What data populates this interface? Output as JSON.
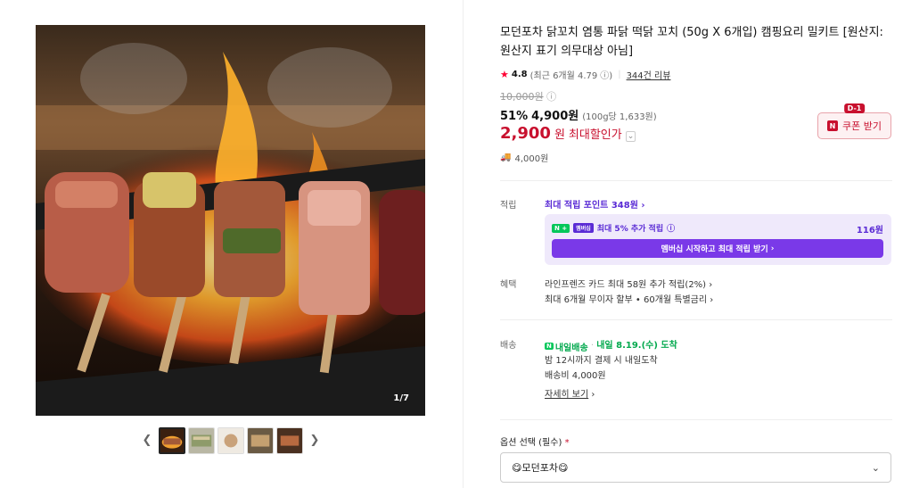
{
  "gallery": {
    "counter": "1/7",
    "prev_icon": "chevron-left-icon",
    "next_icon": "chevron-right-icon",
    "thumbnails": [
      "thumbnail-1",
      "thumbnail-2",
      "thumbnail-3",
      "thumbnail-4",
      "thumbnail-5"
    ]
  },
  "product": {
    "title": "모던포차 닭꼬치 염통 파닭 떡닭 꼬치 (50g X 6개입) 캠핑요리 밀키트 [원산지:원산지 표기 의무대상 아님]",
    "rating": "4.8",
    "rating_recent": "(최근 6개월 4.79",
    "reviews": "344건 리뷰",
    "original_price": "10,000원",
    "discount_rate": "51%",
    "discount_price": "4,900원",
    "unit_price": "(100g당 1,633원)",
    "max_price": "2,900",
    "max_price_unit": "원",
    "max_label": "최대할인가",
    "shipping_fee": "4,000원"
  },
  "coupon": {
    "badge": "D-1",
    "label": "쿠폰 받기",
    "n_mark": "N"
  },
  "points": {
    "label": "적립",
    "link": "최대 적립 포인트 348원",
    "n_badge": "N +",
    "membership_badge": "멤버십",
    "extra_text": "최대 5% 추가 적립",
    "extra_amount": "116원",
    "member_button": "멤버십 시작하고 최대 적립 받기"
  },
  "benefits": {
    "label": "혜택",
    "line1": "라인프렌즈 카드 최대 58원 추가 적립(2%)",
    "line2": "최대 6개월 무이자 할부 • 60개월 특별금리"
  },
  "delivery": {
    "label": "배송",
    "badge_n": "N",
    "badge": "내일배송",
    "arrival": "내일 8.19.(수) 도착",
    "line2": "밤 12시까지 결제 시 내일도착",
    "line3": "배송비 4,000원",
    "detail": "자세히 보기"
  },
  "option": {
    "label": "옵션 선택 (필수)",
    "required_mark": "*",
    "selected": "모던포차"
  },
  "colors": {
    "price_red": "#c8102e",
    "purple": "#5a2bd5",
    "green": "#03c75a"
  }
}
